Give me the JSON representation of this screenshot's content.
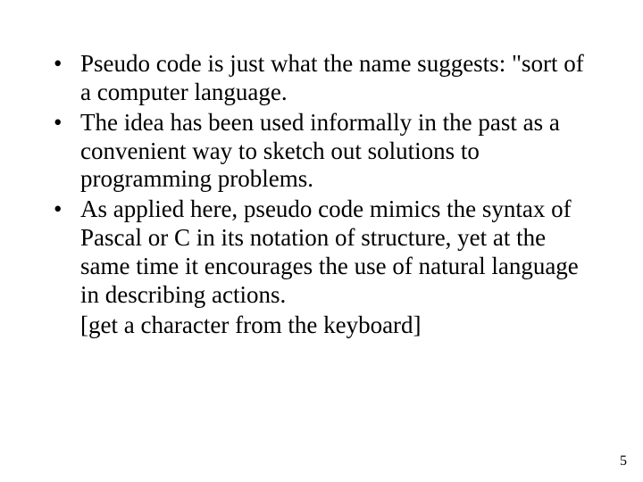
{
  "bullets": [
    "Pseudo code is just what the name suggests: \"sort of a computer language.",
    "The idea has been used informally in the past as a convenient way to sketch out solutions to programming problems.",
    "As applied here, pseudo code mimics the syntax of Pascal or C in its notation of structure, yet at the same time it encourages the use of natural language in describing actions."
  ],
  "extra_line": "[get a character from the keyboard]",
  "page_number": "5"
}
